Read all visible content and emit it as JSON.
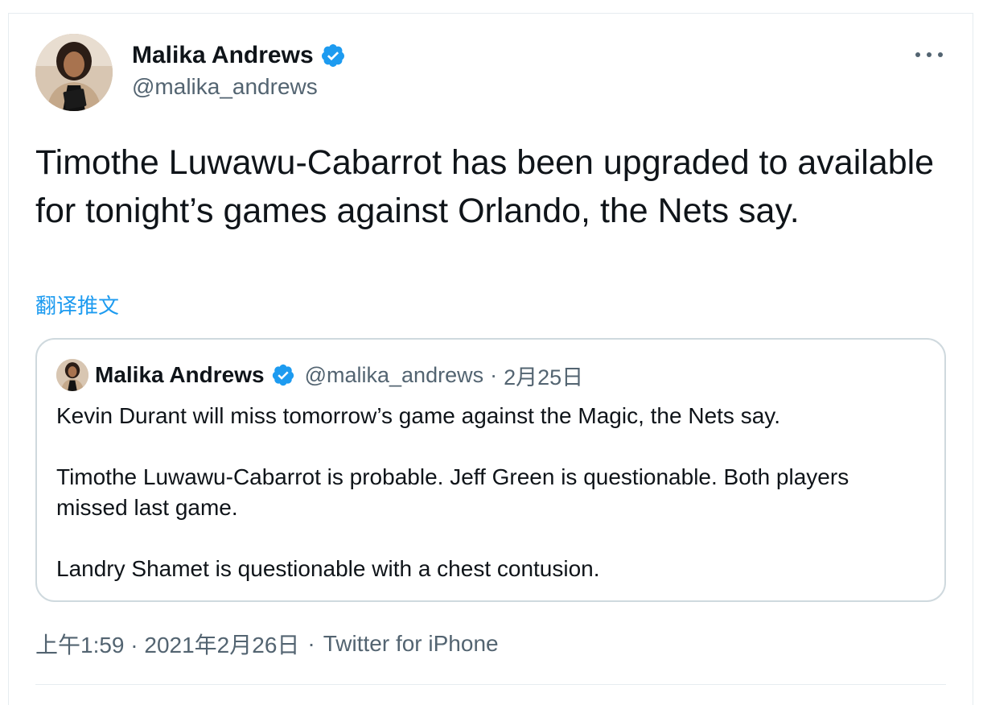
{
  "tweet": {
    "author": {
      "display_name": "Malika Andrews",
      "handle": "@malika_andrews",
      "verified": true
    },
    "text": "Timothe Luwawu-Cabarrot has been upgraded to available for tonight’s games against Orlando, the Nets say.",
    "translate_label": "翻译推文",
    "timestamp": "上午1:59 · 2021年2月26日",
    "separator": "·",
    "source": "Twitter for iPhone"
  },
  "quote": {
    "author": {
      "display_name": "Malika Andrews",
      "handle": "@malika_andrews",
      "verified": true
    },
    "separator": "·",
    "date": "2月25日",
    "paragraphs": [
      "Kevin Durant will miss tomorrow’s game against the Magic, the Nets say.",
      "Timothe Luwawu-Cabarrot is probable. Jeff Green is questionable. Both players missed last game.",
      "Landry Shamet is questionable with a chest contusion."
    ]
  },
  "icons": {
    "verified": "verified-badge-icon",
    "more": "more-options-icon"
  },
  "colors": {
    "accent": "#1d9bf0",
    "text": "#0f1419",
    "secondary": "#536471",
    "border": "#cfd9de"
  }
}
